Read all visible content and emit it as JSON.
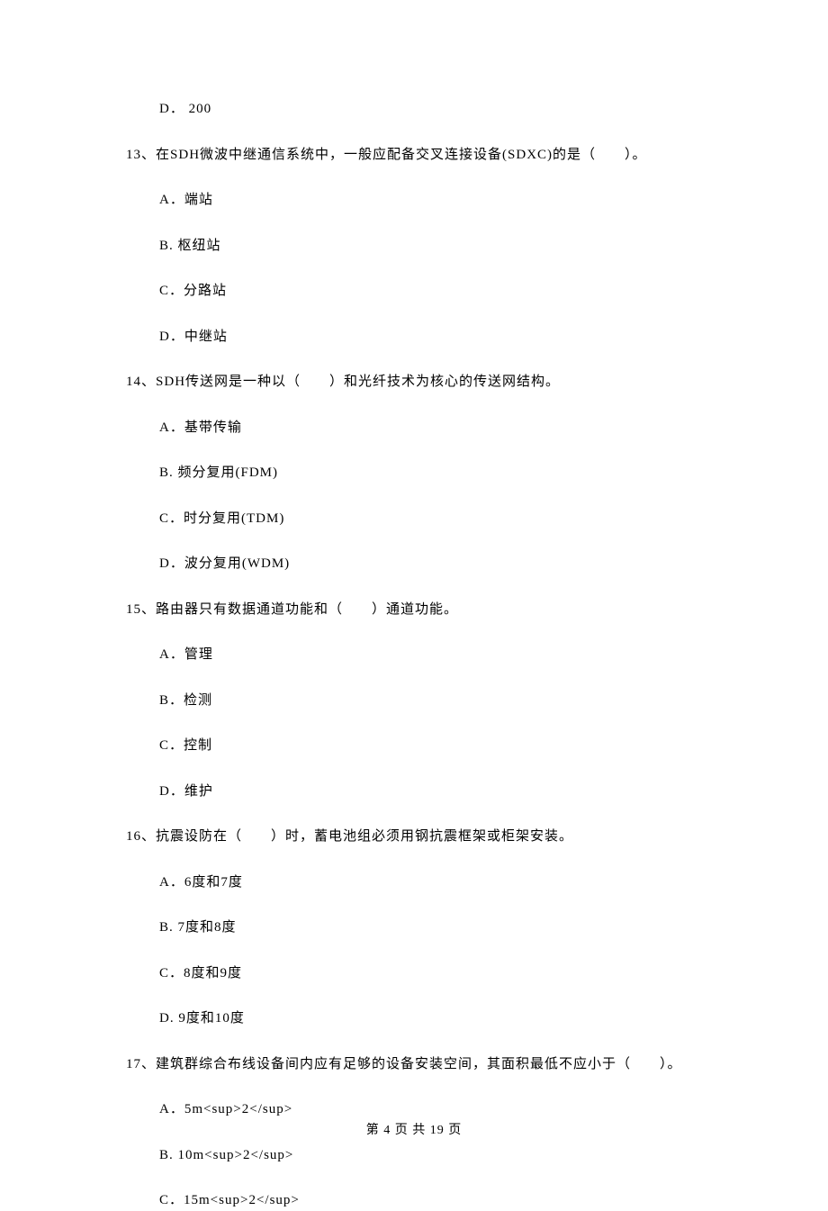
{
  "orphan_option": {
    "letter": "D．",
    "text": "200"
  },
  "questions": [
    {
      "number": "13、",
      "stem": "在SDH微波中继通信系统中，一般应配备交叉连接设备(SDXC)的是（　　）。",
      "options": [
        {
          "letter": "A．",
          "text": "端站"
        },
        {
          "letter": "B.",
          "text": " 枢纽站"
        },
        {
          "letter": "C．",
          "text": "分路站"
        },
        {
          "letter": "D．",
          "text": "中继站"
        }
      ]
    },
    {
      "number": "14、",
      "stem": "SDH传送网是一种以（　　）和光纤技术为核心的传送网结构。",
      "options": [
        {
          "letter": "A．",
          "text": "基带传输"
        },
        {
          "letter": "B.",
          "text": " 频分复用(FDM)"
        },
        {
          "letter": "C．",
          "text": "时分复用(TDM)"
        },
        {
          "letter": "D．",
          "text": "波分复用(WDM)"
        }
      ]
    },
    {
      "number": "15、",
      "stem": "路由器只有数据通道功能和（　　）通道功能。",
      "options": [
        {
          "letter": "A．",
          "text": "管理"
        },
        {
          "letter": "B．",
          "text": "检测"
        },
        {
          "letter": "C．",
          "text": "控制"
        },
        {
          "letter": "D．",
          "text": "维护"
        }
      ]
    },
    {
      "number": "16、",
      "stem": "抗震设防在（　　）时，蓄电池组必须用钢抗震框架或柜架安装。",
      "options": [
        {
          "letter": "A．",
          "text": "6度和7度"
        },
        {
          "letter": "B.",
          "text": " 7度和8度"
        },
        {
          "letter": "C．",
          "text": "8度和9度"
        },
        {
          "letter": "D.",
          "text": " 9度和10度"
        }
      ]
    },
    {
      "number": "17、",
      "stem": "建筑群综合布线设备间内应有足够的设备安装空间，其面积最低不应小于（　　）。",
      "options": [
        {
          "letter": "A．",
          "text": "5m<sup>2</sup>"
        },
        {
          "letter": "B.",
          "text": " 10m<sup>2</sup>"
        },
        {
          "letter": "C．",
          "text": "15m<sup>2</sup>"
        }
      ]
    }
  ],
  "footer": "第 4 页 共 19 页"
}
